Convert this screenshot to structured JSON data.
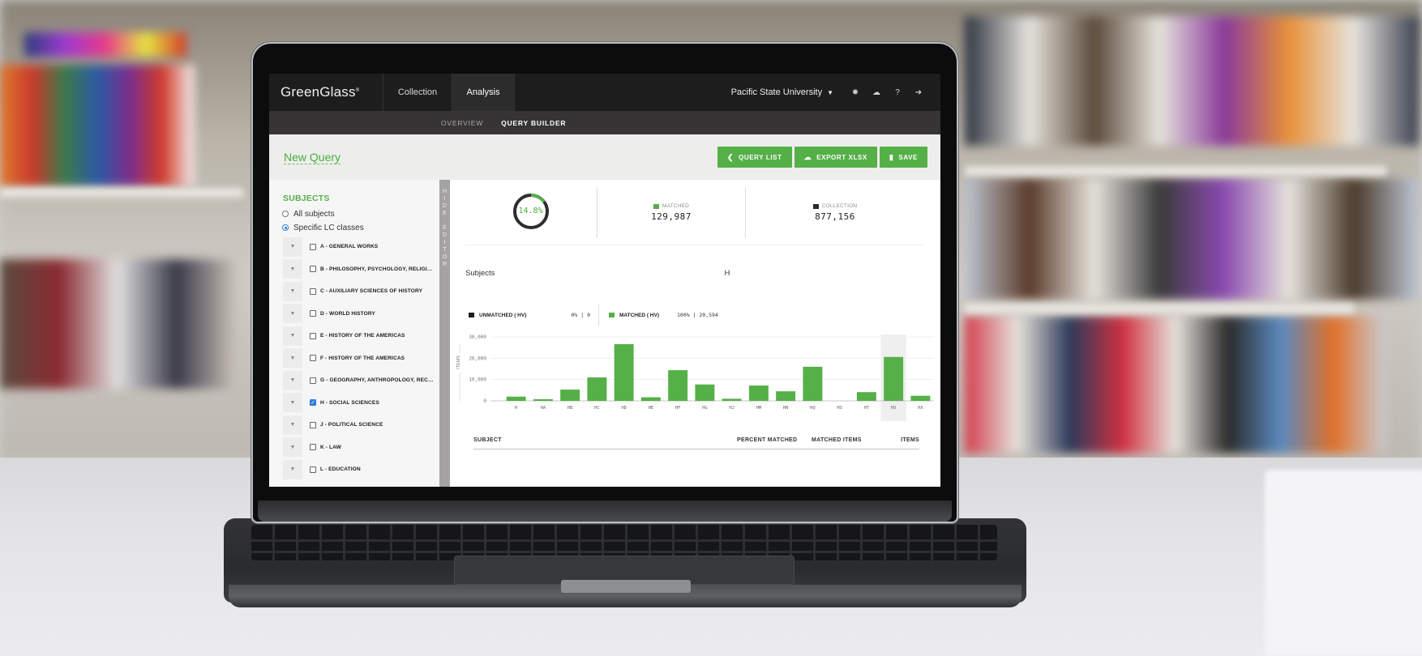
{
  "app": {
    "brand": "GreenGlass",
    "brand_mark": "®",
    "nav_tabs": [
      {
        "label": "Collection",
        "active": false
      },
      {
        "label": "Analysis",
        "active": true
      }
    ],
    "institution": "Pacific State University",
    "header_icons": [
      "gear-icon",
      "cloud-download-icon",
      "help-icon",
      "logout-icon"
    ],
    "subnav": [
      {
        "label": "OVERVIEW",
        "active": false
      },
      {
        "label": "QUERY BUILDER",
        "active": true
      }
    ]
  },
  "query": {
    "title": "New Query",
    "buttons": [
      {
        "label": "QUERY LIST",
        "icon": "chevron-left-icon"
      },
      {
        "label": "EXPORT XLSX",
        "icon": "cloud-download-icon"
      },
      {
        "label": "SAVE",
        "icon": "bookmark-icon"
      }
    ]
  },
  "sidebar": {
    "title": "SUBJECTS",
    "radios": [
      {
        "label": "All subjects",
        "checked": false
      },
      {
        "label": "Specific LC classes",
        "checked": true
      }
    ],
    "lc_classes": [
      {
        "label": "A - GENERAL WORKS",
        "checked": false
      },
      {
        "label": "B - PHILOSOPHY, PSYCHOLOGY, RELIGION",
        "checked": false
      },
      {
        "label": "C - AUXILIARY SCIENCES OF HISTORY",
        "checked": false
      },
      {
        "label": "D - WORLD HISTORY",
        "checked": false
      },
      {
        "label": "E - HISTORY OF THE AMERICAS",
        "checked": false
      },
      {
        "label": "F - HISTORY OF THE AMERICAS",
        "checked": false
      },
      {
        "label": "G - GEOGRAPHY, ANTHROPOLOGY, RECREATI...",
        "checked": false
      },
      {
        "label": "H - SOCIAL SCIENCES",
        "checked": true
      },
      {
        "label": "J - POLITICAL SCIENCE",
        "checked": false
      },
      {
        "label": "K - LAW",
        "checked": false
      },
      {
        "label": "L - EDUCATION",
        "checked": false
      }
    ],
    "hide_editor_label": "HIDE EDITOR"
  },
  "stats": {
    "percent_label": "14.8%",
    "percent_value": 14.8,
    "matched_label": "MATCHED",
    "matched_value": "129,987",
    "collection_label": "COLLECTION",
    "collection_value": "877,156"
  },
  "section": {
    "title": "Subjects",
    "selected_class": "H"
  },
  "legend": {
    "unmatched_label": "UNMATCHED ( HV)",
    "unmatched_value": "0% | 0",
    "matched_label": "MATCHED ( HV)",
    "matched_value": "100% | 20,594"
  },
  "colors": {
    "accent": "#55b047",
    "unmatched": "#1e1e1e",
    "nav_bg": "#1e1d1d",
    "highlight_band": "#efefef"
  },
  "chart_data": {
    "type": "bar",
    "title": "Subjects",
    "xlabel": "",
    "ylabel": "ITEMS",
    "ylim": [
      0,
      30000
    ],
    "yticks": [
      0,
      10000,
      20000,
      30000
    ],
    "ytick_labels": [
      "0",
      "10,000",
      "20,000",
      "30,000"
    ],
    "grid": true,
    "highlighted": "HV",
    "categories": [
      "H",
      "HA",
      "HB",
      "HC",
      "HD",
      "HE",
      "HF",
      "HG",
      "HJ",
      "HM",
      "HN",
      "HQ",
      "HS",
      "HT",
      "HV",
      "HX"
    ],
    "series": [
      {
        "name": "Matched",
        "values": [
          2000,
          800,
          5300,
          11000,
          26600,
          1700,
          14400,
          7700,
          1000,
          7200,
          4500,
          16000,
          0,
          4100,
          20594,
          2400
        ]
      }
    ]
  },
  "table": {
    "columns": [
      "SUBJECT",
      "PERCENT MATCHED",
      "MATCHED ITEMS",
      "ITEMS"
    ]
  }
}
